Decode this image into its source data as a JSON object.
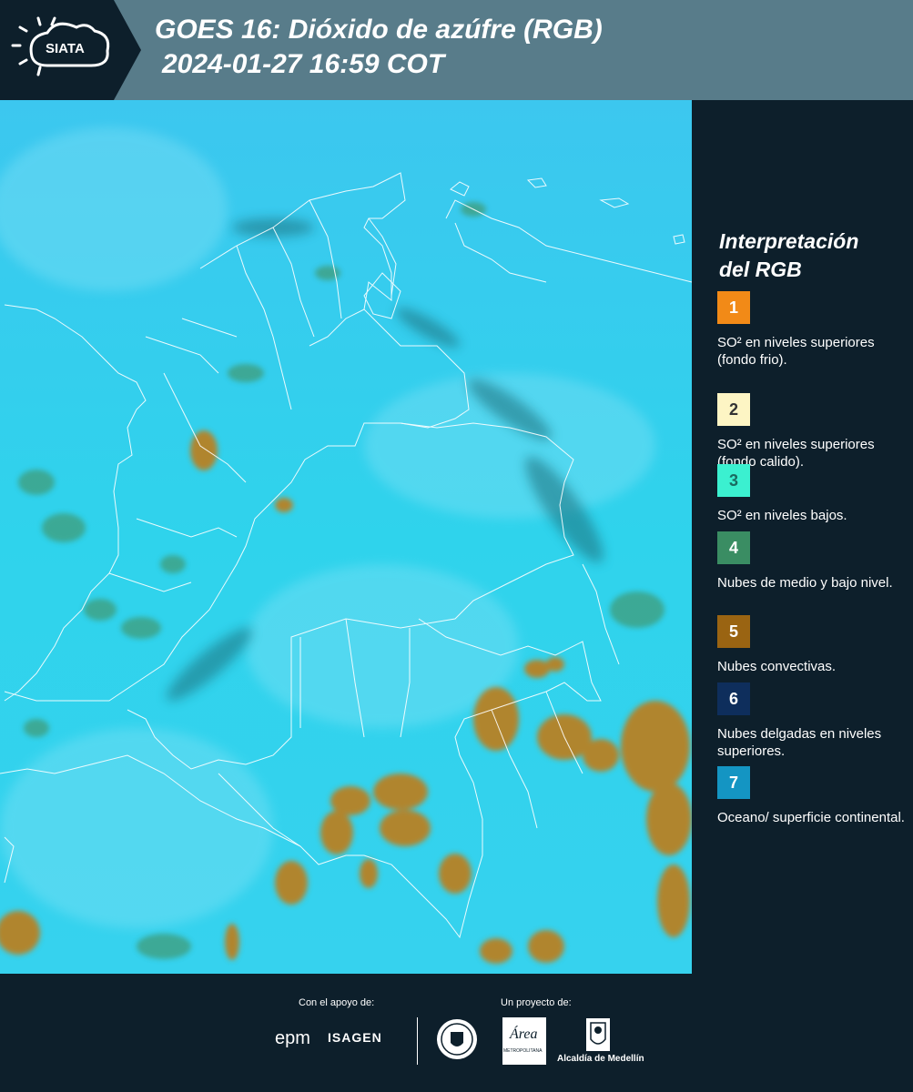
{
  "header": {
    "logo_text": "SIATA",
    "title_line1": "GOES 16: Dióxido de azúfre (RGB)",
    "title_line2": "2024-01-27 16:59 COT"
  },
  "legend": {
    "title_line1": "Interpretación",
    "title_line2": "del RGB",
    "items": [
      {
        "num": "1",
        "color": "#f28a17",
        "num_color": "#ffffff",
        "label": "SO² en niveles superiores (fondo frio)."
      },
      {
        "num": "2",
        "color": "#fdf5c4",
        "num_color": "#333333",
        "label": "SO² en niveles superiores (fondo calido)."
      },
      {
        "num": "3",
        "color": "#3bf0d0",
        "num_color": "#1a6b60",
        "label": "SO² en niveles bajos."
      },
      {
        "num": "4",
        "color": "#3a8d63",
        "num_color": "#ffffff",
        "label": "Nubes de medio y bajo nivel."
      },
      {
        "num": "5",
        "color": "#9a6412",
        "num_color": "#ffffff",
        "label": "Nubes convectivas."
      },
      {
        "num": "6",
        "color": "#0e2e5c",
        "num_color": "#ffffff",
        "label": "Nubes delgadas en niveles superiores."
      },
      {
        "num": "7",
        "color": "#1495c3",
        "num_color": "#ffffff",
        "label": "Oceano/ superficie continental."
      }
    ]
  },
  "footer": {
    "support_label": "Con el apoyo de:",
    "project_label": "Un proyecto de:",
    "epm": "epm",
    "isagen": "ISAGEN",
    "area_text": "Área",
    "area_sub": "METROPOLITANA",
    "alcaldia": "Alcaldía de Medellín"
  }
}
